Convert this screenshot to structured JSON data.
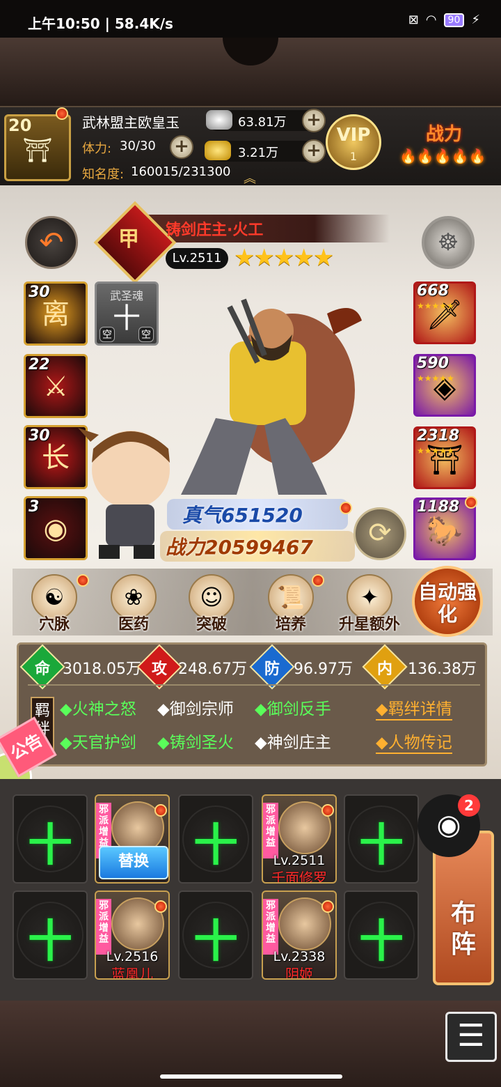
{
  "status_bar": {
    "time_speed": "上午10:50 | 58.4K/s",
    "battery": "90"
  },
  "player": {
    "level": "20",
    "name": "武林盟主欧皇玉",
    "stamina_label": "体力:",
    "stamina_value": "30/30",
    "fame_label": "知名度:",
    "fame_value": "160015/231300",
    "silver": "63.81万",
    "gold": "3.21万",
    "vip_label": "VIP",
    "vip_level": "1",
    "power_label": "战力"
  },
  "hero": {
    "rank": "甲",
    "title": "铸剑庄主·火工",
    "level": "Lv.2511",
    "stars": "★★★★★",
    "qi": "真气651520",
    "power": "战力20599467"
  },
  "skills": [
    {
      "num": "30",
      "glyph": "离",
      "color": "#e8a020"
    },
    {
      "num": "22",
      "glyph": "⚔",
      "color": "#b01818"
    },
    {
      "num": "30",
      "glyph": "长",
      "color": "#c01818"
    },
    {
      "num": "3",
      "glyph": "◉",
      "color": "#5a1010"
    }
  ],
  "soul_slot": {
    "title": "武圣魂",
    "glyph": "十",
    "empty_left": "空",
    "empty_right": "空"
  },
  "equipment": [
    {
      "num": "668",
      "glyph": "🗡",
      "color": "#b01818"
    },
    {
      "num": "590",
      "glyph": "◈",
      "color": "#7a1aa8"
    },
    {
      "num": "2318",
      "glyph": "⛩",
      "color": "#b01818"
    },
    {
      "num": "1188",
      "glyph": "🐎",
      "color": "#7a1aa8"
    }
  ],
  "actions": [
    {
      "label": "穴脉",
      "icon": "☯"
    },
    {
      "label": "医药",
      "icon": "❀"
    },
    {
      "label": "突破",
      "icon": "☺"
    },
    {
      "label": "培养",
      "icon": "📜"
    },
    {
      "label": "升星额外",
      "icon": "✦"
    }
  ],
  "auto_strengthen": "自动强化",
  "stats": [
    {
      "char": "命",
      "value": "3018.05万",
      "color": "#1aa83a"
    },
    {
      "char": "攻",
      "value": "248.67万",
      "color": "#d01a1a"
    },
    {
      "char": "防",
      "value": "96.97万",
      "color": "#1a6ad0"
    },
    {
      "char": "内",
      "value": "136.38万",
      "color": "#e0a010"
    }
  ],
  "bond_tag": "羁绊",
  "bonds_row1": [
    {
      "text": "◆火神之怒",
      "active": true
    },
    {
      "text": "◆御剑宗师",
      "active": false
    },
    {
      "text": "◆御剑反手",
      "active": true
    }
  ],
  "bonds_row2": [
    {
      "text": "◆天官护剑",
      "active": true
    },
    {
      "text": "◆铸剑圣火",
      "active": true
    },
    {
      "text": "◆神剑庄主",
      "active": false
    }
  ],
  "bond_details": "◆羁绊详情",
  "biography": "◆人物传记",
  "notice": "公告",
  "lineup": {
    "plus": "十",
    "sect_tag": "邪派增益",
    "replace": "替换",
    "heroes": [
      {
        "level": "Lv.2511",
        "name": "千面修罗"
      },
      {
        "level": "Lv.2516",
        "name": "蓝凰儿"
      },
      {
        "level": "Lv.2338",
        "name": "阴姬"
      }
    ]
  },
  "formation": "布阵",
  "share_badge": "2"
}
